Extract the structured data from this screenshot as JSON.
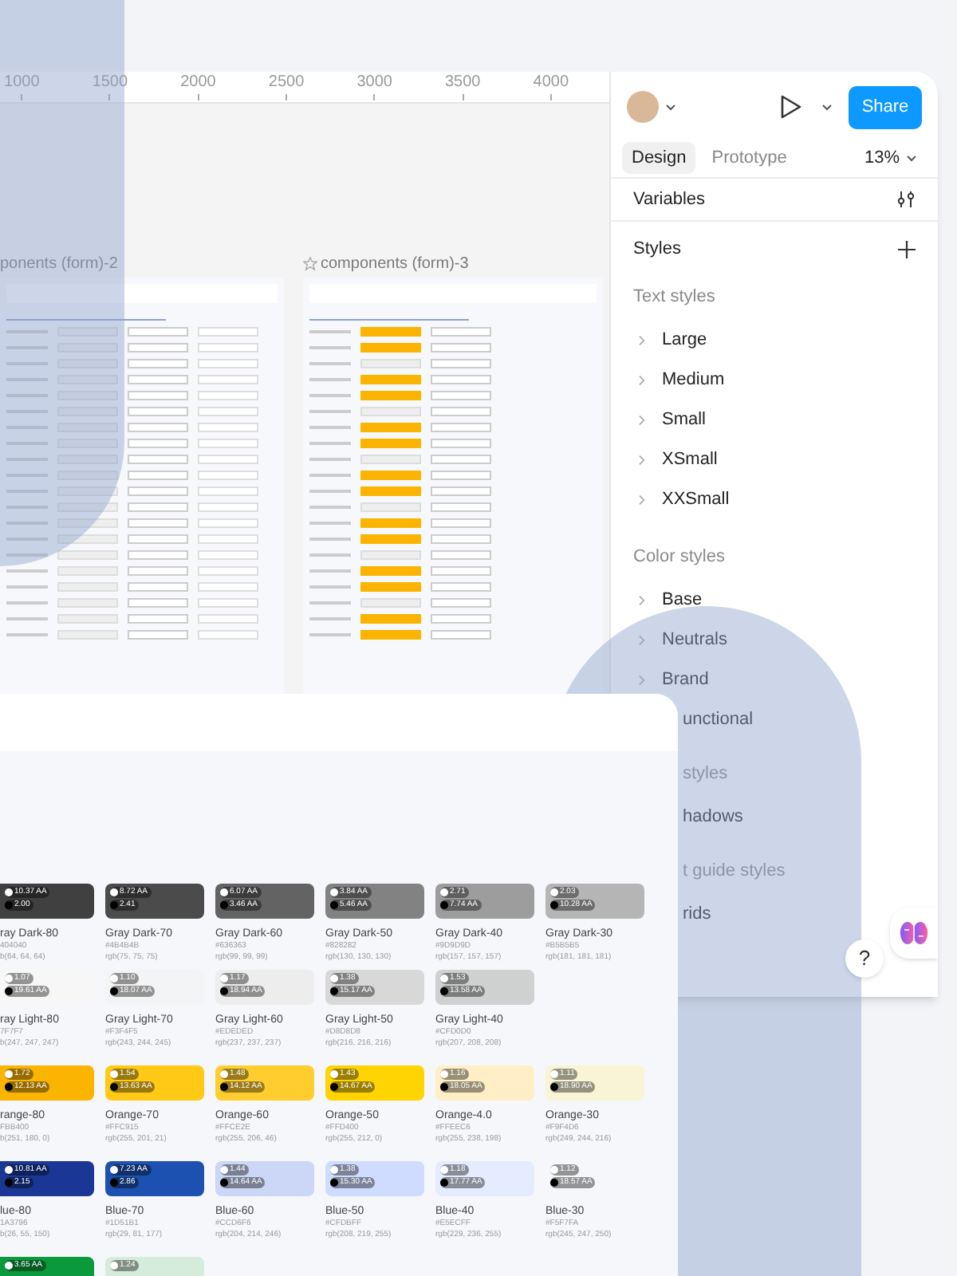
{
  "ruler": {
    "ticks": [
      "1000",
      "1500",
      "2000",
      "2500",
      "3000",
      "3500",
      "4000"
    ]
  },
  "canvas": {
    "frames": [
      {
        "title": "ponents (form)-2",
        "starred": false
      },
      {
        "title": "components (form)-3",
        "starred": true
      }
    ]
  },
  "panel": {
    "share": "Share",
    "zoom": "13%",
    "tabs": [
      {
        "label": "Design",
        "selected": true
      },
      {
        "label": "Prototype",
        "selected": false
      }
    ],
    "variables": "Variables",
    "styles": "Styles",
    "help": "?",
    "sections": [
      {
        "title": "Text styles",
        "kind": "full",
        "items": [
          {
            "label": "Large",
            "kind": "full"
          },
          {
            "label": "Medium",
            "kind": "full"
          },
          {
            "label": "Small",
            "kind": "full"
          },
          {
            "label": "XSmall",
            "kind": "full"
          },
          {
            "label": "XXSmall",
            "kind": "full"
          }
        ]
      },
      {
        "title": "Color styles",
        "kind": "full",
        "items": [
          {
            "label": "Base",
            "kind": "full"
          },
          {
            "label": "Neutrals",
            "kind": "full"
          },
          {
            "label": "Brand",
            "kind": "full"
          },
          {
            "label": "unctional",
            "kind": "clipped"
          }
        ]
      },
      {
        "title": "styles",
        "kind": "clipped",
        "items": [
          {
            "label": "hadows",
            "kind": "clipped"
          }
        ]
      },
      {
        "title": "t guide styles",
        "kind": "clipped",
        "items": [
          {
            "label": "rids",
            "kind": "clipped"
          }
        ]
      }
    ]
  },
  "swatch_groups": [
    {
      "rows": [
        [
          {
            "name": "ray Dark-80",
            "hex": "404040",
            "rgb": "b(64, 64, 64)",
            "color": "#404040",
            "light": "10.37 AA",
            "dark": "2.00"
          },
          {
            "name": "Gray Dark-70",
            "hex": "#4B4B4B",
            "rgb": "rgb(75, 75, 75)",
            "color": "#4b4b4b",
            "light": "8.72 AA",
            "dark": "2.41"
          },
          {
            "name": "Gray Dark-60",
            "hex": "#636363",
            "rgb": "rgb(99, 99, 99)",
            "color": "#636363",
            "light": "6.07 AA",
            "dark": "3.46 AA"
          },
          {
            "name": "Gray Dark-50",
            "hex": "#828282",
            "rgb": "rgb(130, 130, 130)",
            "color": "#828282",
            "light": "3.84 AA",
            "dark": "5.46 AA"
          },
          {
            "name": "Gray Dark-40",
            "hex": "#9D9D9D",
            "rgb": "rgb(157, 157, 157)",
            "color": "#9d9d9d",
            "light": "2.71",
            "dark": "7.74 AA"
          },
          {
            "name": "Gray Dark-30",
            "hex": "#B5B5B5",
            "rgb": "rgb(181, 181, 181)",
            "color": "#b5b5b5",
            "light": "2.03",
            "dark": "10.28 AA"
          }
        ],
        [
          {
            "name": "ray Light-80",
            "hex": "7F7F7",
            "rgb": "b(247, 247, 247)",
            "color": "#f7f7f7",
            "light": "1.07",
            "dark": "19.61 AA"
          },
          {
            "name": "Gray Light-70",
            "hex": "#F3F4F5",
            "rgb": "rgb(243, 244, 245)",
            "color": "#f3f4f5",
            "light": "1.10",
            "dark": "18.07 AA"
          },
          {
            "name": "Gray Light-60",
            "hex": "#EDEDED",
            "rgb": "rgb(237, 237, 237)",
            "color": "#ededed",
            "light": "1.17",
            "dark": "18.94 AA"
          },
          {
            "name": "Gray Light-50",
            "hex": "#D8D8D8",
            "rgb": "rgb(216, 216, 216)",
            "color": "#d8d8d8",
            "light": "1.38",
            "dark": "15.17 AA"
          },
          {
            "name": "Gray Light-40",
            "hex": "#CFD0D0",
            "rgb": "rgb(207, 208, 208)",
            "color": "#cfd0d0",
            "light": "1.53",
            "dark": "13.58 AA"
          }
        ]
      ]
    },
    {
      "rows": [
        [
          {
            "name": "range-80",
            "hex": "FBB400",
            "rgb": "b(251, 180, 0)",
            "color": "#fbb400",
            "light": "1.72",
            "dark": "12.13 AA"
          },
          {
            "name": "Orange-70",
            "hex": "#FFC915",
            "rgb": "rgb(255, 201, 21)",
            "color": "#ffc915",
            "light": "1.54",
            "dark": "13.63 AA"
          },
          {
            "name": "Orange-60",
            "hex": "#FFCE2E",
            "rgb": "rgb(255, 206, 46)",
            "color": "#ffce2e",
            "light": "1.48",
            "dark": "14.12 AA"
          },
          {
            "name": "Orange-50",
            "hex": "#FFD400",
            "rgb": "rgb(255, 212, 0)",
            "color": "#ffd400",
            "light": "1.43",
            "dark": "14.67 AA"
          },
          {
            "name": "Orange-4.0",
            "hex": "#FFEEC6",
            "rgb": "rgb(255, 238, 198)",
            "color": "#ffeec6",
            "light": "1.16",
            "dark": "18.05 AA"
          },
          {
            "name": "Orange-30",
            "hex": "#F9F4D6",
            "rgb": "rgb(249, 244, 216)",
            "color": "#f9f4d6",
            "light": "1.11",
            "dark": "18.90 AA"
          }
        ]
      ]
    },
    {
      "rows": [
        [
          {
            "name": "lue-80",
            "hex": "1A3796",
            "rgb": "b(26, 55, 150)",
            "color": "#1a3796",
            "light": "10.81 AA",
            "dark": "2.15"
          },
          {
            "name": "Blue-70",
            "hex": "#1D51B1",
            "rgb": "rgb(29, 81, 177)",
            "color": "#1d51b1",
            "light": "7.23 AA",
            "dark": "2.86"
          },
          {
            "name": "Blue-60",
            "hex": "#CCD6F6",
            "rgb": "rgb(204, 214, 246)",
            "color": "#ccd6f6",
            "light": "1.44",
            "dark": "14.64 AA"
          },
          {
            "name": "Blue-50",
            "hex": "#CFDBFF",
            "rgb": "rgb(208, 219, 255)",
            "color": "#cfdbff",
            "light": "1.38",
            "dark": "15.30 AA"
          },
          {
            "name": "Blue-40",
            "hex": "#E5ECFF",
            "rgb": "rgb(229, 236, 255)",
            "color": "#e5ecff",
            "light": "1.18",
            "dark": "17.77 AA"
          },
          {
            "name": "Blue-30",
            "hex": "#F5F7FA",
            "rgb": "rgb(245, 247, 250)",
            "color": "#f5f7fa",
            "light": "1.12",
            "dark": "18.57 AA"
          }
        ]
      ]
    },
    {
      "rows": [
        [
          {
            "color": "#0a9a3b",
            "light": "3.65 AA"
          },
          {
            "color": "#d5ecdb",
            "light": "1.24"
          }
        ]
      ]
    }
  ]
}
